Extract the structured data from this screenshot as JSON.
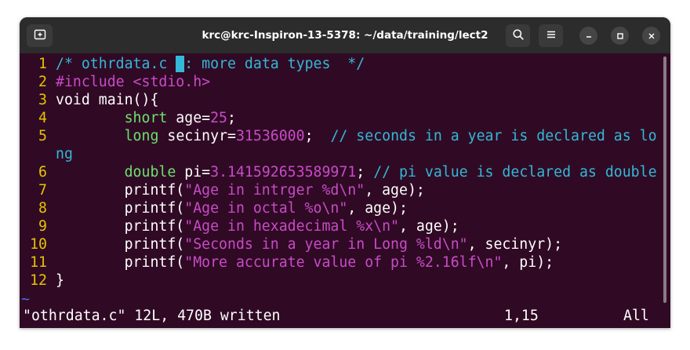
{
  "window": {
    "title": "krc@krc-Inspiron-13-5378: ~/data/training/lect2",
    "icons": {
      "new_tab": "new-tab-icon",
      "search": "search-icon",
      "menu": "hamburger-menu-icon",
      "minimize": "minimize-icon",
      "maximize": "maximize-icon",
      "close": "close-icon"
    }
  },
  "editor": {
    "lines": [
      {
        "num": "1",
        "segs": [
          [
            "cmt",
            "/* othrdata.c "
          ],
          [
            "cursor",
            " "
          ],
          [
            "cmt",
            ": more data types  */"
          ]
        ]
      },
      {
        "num": "2",
        "segs": [
          [
            "pp",
            "#include <stdio.h>"
          ]
        ]
      },
      {
        "num": "3",
        "segs": [
          [
            "plain",
            "void main(){"
          ]
        ]
      },
      {
        "num": "4",
        "segs": [
          [
            "plain",
            "        "
          ],
          [
            "kw",
            "short"
          ],
          [
            "plain",
            " age="
          ],
          [
            "num",
            "25"
          ],
          [
            "plain",
            ";"
          ]
        ]
      },
      {
        "num": "5",
        "segs": [
          [
            "plain",
            "        "
          ],
          [
            "kw",
            "long"
          ],
          [
            "plain",
            " secinyr="
          ],
          [
            "num",
            "31536000"
          ],
          [
            "plain",
            ";  "
          ],
          [
            "cmt",
            "// seconds in a year is declared as lo"
          ]
        ]
      },
      {
        "num": "",
        "segs": [
          [
            "cmt",
            "ng"
          ]
        ]
      },
      {
        "num": "6",
        "segs": [
          [
            "plain",
            "        "
          ],
          [
            "kw",
            "double"
          ],
          [
            "plain",
            " pi="
          ],
          [
            "num",
            "3.141592653589971"
          ],
          [
            "plain",
            "; "
          ],
          [
            "cmt",
            "// pi value is declared as double"
          ]
        ]
      },
      {
        "num": "7",
        "segs": [
          [
            "plain",
            "        printf("
          ],
          [
            "str",
            "\"Age in intrger %d\\n\""
          ],
          [
            "plain",
            ", age);"
          ]
        ]
      },
      {
        "num": "8",
        "segs": [
          [
            "plain",
            "        printf("
          ],
          [
            "str",
            "\"Age in octal %o\\n\""
          ],
          [
            "plain",
            ", age);"
          ]
        ]
      },
      {
        "num": "9",
        "segs": [
          [
            "plain",
            "        printf("
          ],
          [
            "str",
            "\"Age in hexadecimal %x\\n\""
          ],
          [
            "plain",
            ", age);"
          ]
        ]
      },
      {
        "num": "10",
        "segs": [
          [
            "plain",
            "        printf("
          ],
          [
            "str",
            "\"Seconds in a year in Long %ld\\n\""
          ],
          [
            "plain",
            ", secinyr);"
          ]
        ]
      },
      {
        "num": "11",
        "segs": [
          [
            "plain",
            "        printf("
          ],
          [
            "str",
            "\"More accurate value of pi %2.16lf\\n\""
          ],
          [
            "plain",
            ", pi);"
          ]
        ]
      },
      {
        "num": "12",
        "segs": [
          [
            "plain",
            "}"
          ]
        ]
      }
    ],
    "tilde": "~",
    "status_message": "\"othrdata.c\" 12L, 470B written",
    "cursor_position": "1,15",
    "scroll_state": "All"
  },
  "colors": {
    "background": "#300a24",
    "titlebar": "#2c2c2c",
    "line_number": "#e6c200",
    "comment": "#34b8d8",
    "constant": "#c84bc8",
    "type_keyword": "#6ee06e",
    "tilde": "#4b6cf0"
  }
}
